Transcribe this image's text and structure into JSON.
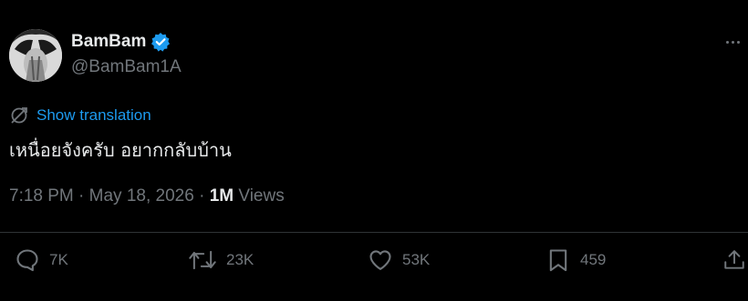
{
  "author": {
    "display_name": "BamBam",
    "handle": "@BamBam1A",
    "verified": true,
    "avatar_icon": "avatar-image"
  },
  "translation": {
    "label": "Show translation",
    "icon": "translate-icon"
  },
  "tweet": {
    "text": "เหนื่อยจังครับ อยากกลับบ้าน"
  },
  "meta": {
    "time": "7:18 PM",
    "separator1": " · ",
    "date": "May 18, 2026",
    "separator2": " · ",
    "views_count": "1M",
    "views_label": " Views"
  },
  "actions": {
    "replies": "7K",
    "reposts": "23K",
    "likes": "53K",
    "bookmarks": "459"
  },
  "colors": {
    "background": "#000000",
    "text": "#e7e9ea",
    "secondary": "#71767b",
    "accent": "#1d9bf0",
    "divider": "#2f3336"
  }
}
